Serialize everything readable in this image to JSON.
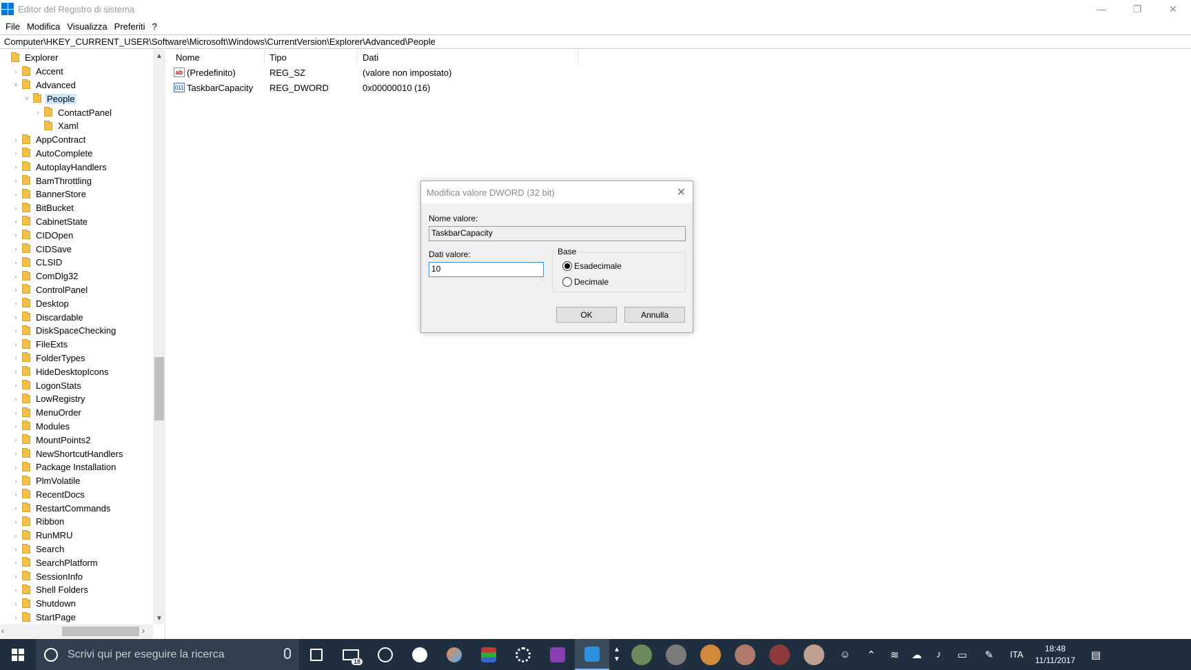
{
  "window": {
    "title": "Editor del Registro di sistema",
    "minimize": "—",
    "maximize": "❐",
    "close": "✕"
  },
  "menu": [
    "File",
    "Modifica",
    "Visualizza",
    "Preferiti",
    "?"
  ],
  "address": "Computer\\HKEY_CURRENT_USER\\Software\\Microsoft\\Windows\\CurrentVersion\\Explorer\\Advanced\\People",
  "tree": [
    {
      "label": "Explorer",
      "level": 0,
      "exp": ""
    },
    {
      "label": "Accent",
      "level": 1,
      "exp": "›"
    },
    {
      "label": "Advanced",
      "level": 1,
      "exp": "˅"
    },
    {
      "label": "People",
      "level": 2,
      "exp": "˅",
      "selected": true
    },
    {
      "label": "ContactPanel",
      "level": 3,
      "exp": "›"
    },
    {
      "label": "Xaml",
      "level": 3,
      "exp": ""
    },
    {
      "label": "AppContract",
      "level": 1,
      "exp": "›"
    },
    {
      "label": "AutoComplete",
      "level": 1,
      "exp": "›"
    },
    {
      "label": "AutoplayHandlers",
      "level": 1,
      "exp": "›"
    },
    {
      "label": "BamThrottling",
      "level": 1,
      "exp": "›"
    },
    {
      "label": "BannerStore",
      "level": 1,
      "exp": "›"
    },
    {
      "label": "BitBucket",
      "level": 1,
      "exp": "›"
    },
    {
      "label": "CabinetState",
      "level": 1,
      "exp": "›"
    },
    {
      "label": "CIDOpen",
      "level": 1,
      "exp": "›"
    },
    {
      "label": "CIDSave",
      "level": 1,
      "exp": "›"
    },
    {
      "label": "CLSID",
      "level": 1,
      "exp": "›"
    },
    {
      "label": "ComDlg32",
      "level": 1,
      "exp": "›"
    },
    {
      "label": "ControlPanel",
      "level": 1,
      "exp": "›"
    },
    {
      "label": "Desktop",
      "level": 1,
      "exp": "›"
    },
    {
      "label": "Discardable",
      "level": 1,
      "exp": "›"
    },
    {
      "label": "DiskSpaceChecking",
      "level": 1,
      "exp": "›"
    },
    {
      "label": "FileExts",
      "level": 1,
      "exp": "›"
    },
    {
      "label": "FolderTypes",
      "level": 1,
      "exp": "›"
    },
    {
      "label": "HideDesktopIcons",
      "level": 1,
      "exp": "›"
    },
    {
      "label": "LogonStats",
      "level": 1,
      "exp": "›"
    },
    {
      "label": "LowRegistry",
      "level": 1,
      "exp": "›"
    },
    {
      "label": "MenuOrder",
      "level": 1,
      "exp": "›"
    },
    {
      "label": "Modules",
      "level": 1,
      "exp": "›"
    },
    {
      "label": "MountPoints2",
      "level": 1,
      "exp": "›"
    },
    {
      "label": "NewShortcutHandlers",
      "level": 1,
      "exp": "›"
    },
    {
      "label": "Package Installation",
      "level": 1,
      "exp": "›"
    },
    {
      "label": "PlmVolatile",
      "level": 1,
      "exp": "›"
    },
    {
      "label": "RecentDocs",
      "level": 1,
      "exp": "›"
    },
    {
      "label": "RestartCommands",
      "level": 1,
      "exp": "›"
    },
    {
      "label": "Ribbon",
      "level": 1,
      "exp": "›"
    },
    {
      "label": "RunMRU",
      "level": 1,
      "exp": "›"
    },
    {
      "label": "Search",
      "level": 1,
      "exp": "›"
    },
    {
      "label": "SearchPlatform",
      "level": 1,
      "exp": "›"
    },
    {
      "label": "SessionInfo",
      "level": 1,
      "exp": "›"
    },
    {
      "label": "Shell Folders",
      "level": 1,
      "exp": "›"
    },
    {
      "label": "Shutdown",
      "level": 1,
      "exp": "›"
    },
    {
      "label": "StartPage",
      "level": 1,
      "exp": "›"
    }
  ],
  "list": {
    "headers": [
      "Nome",
      "Tipo",
      "Dati"
    ],
    "rows": [
      {
        "icon": "ab",
        "name": "(Predefinito)",
        "type": "REG_SZ",
        "data": "(valore non impostato)"
      },
      {
        "icon": "011",
        "name": "TaskbarCapacity",
        "type": "REG_DWORD",
        "data": "0x00000010 (16)"
      }
    ]
  },
  "dialog": {
    "title": "Modifica valore DWORD (32 bit)",
    "close": "✕",
    "name_label": "Nome valore:",
    "name_value": "TaskbarCapacity",
    "value_label": "Dati valore:",
    "value_value": "10",
    "base_label": "Base",
    "hex_label": "Esadecimale",
    "dec_label": "Decimale",
    "ok": "OK",
    "cancel": "Annulla"
  },
  "taskbar": {
    "search_placeholder": "Scrivi qui per eseguire la ricerca",
    "mail_badge": "18",
    "lang": "ITA",
    "time": "18:48",
    "date": "11/11/2017"
  }
}
